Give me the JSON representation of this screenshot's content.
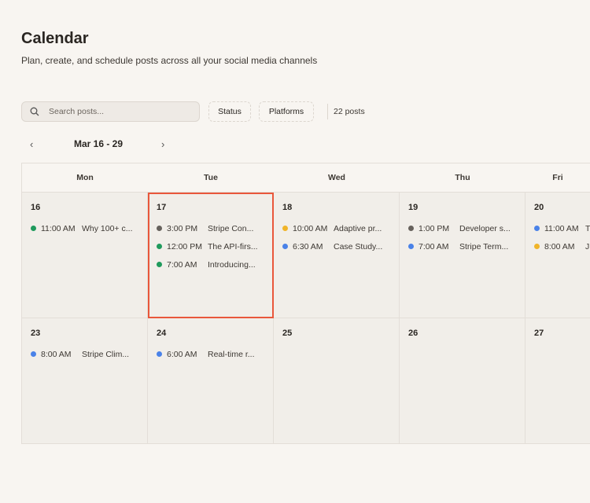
{
  "header": {
    "title": "Calendar",
    "subtitle": "Plan, create, and schedule posts across all your social media channels"
  },
  "toolbar": {
    "search_placeholder": "Search posts...",
    "status_label": "Status",
    "platforms_label": "Platforms",
    "post_count": "22 posts"
  },
  "nav": {
    "prev": "‹",
    "next": "›",
    "range": "Mar 16 - 29"
  },
  "colors": {
    "green": "#1f9a5c",
    "gray": "#66615c",
    "blue": "#4a82e8",
    "yellow": "#f0b429",
    "selected": "#e9573b"
  },
  "weekdays": [
    "Mon",
    "Tue",
    "Wed",
    "Thu",
    "Fri"
  ],
  "weeks": [
    [
      {
        "day": "16",
        "events": [
          {
            "time": "11:00 AM",
            "title": "Why 100+ c...",
            "color": "green"
          }
        ]
      },
      {
        "day": "17",
        "selected": true,
        "events": [
          {
            "time": "3:00 PM",
            "title": "Stripe Con...",
            "color": "gray"
          },
          {
            "time": "12:00 PM",
            "title": "The API-firs...",
            "color": "green"
          },
          {
            "time": "7:00 AM",
            "title": "Introducing...",
            "color": "green"
          }
        ]
      },
      {
        "day": "18",
        "events": [
          {
            "time": "10:00 AM",
            "title": "Adaptive pr...",
            "color": "yellow"
          },
          {
            "time": "6:30 AM",
            "title": "Case Study...",
            "color": "blue"
          }
        ]
      },
      {
        "day": "19",
        "events": [
          {
            "time": "1:00 PM",
            "title": "Developer s...",
            "color": "gray"
          },
          {
            "time": "7:00 AM",
            "title": "Stripe Term...",
            "color": "blue"
          }
        ]
      },
      {
        "day": "20",
        "events": [
          {
            "time": "11:00 AM",
            "title": "T",
            "color": "blue"
          },
          {
            "time": "8:00 AM",
            "title": "J",
            "color": "yellow"
          }
        ]
      }
    ],
    [
      {
        "day": "23",
        "events": [
          {
            "time": "8:00 AM",
            "title": "Stripe Clim...",
            "color": "blue"
          }
        ]
      },
      {
        "day": "24",
        "events": [
          {
            "time": "6:00 AM",
            "title": "Real-time r...",
            "color": "blue"
          }
        ]
      },
      {
        "day": "25",
        "events": []
      },
      {
        "day": "26",
        "events": []
      },
      {
        "day": "27",
        "events": []
      }
    ]
  ]
}
